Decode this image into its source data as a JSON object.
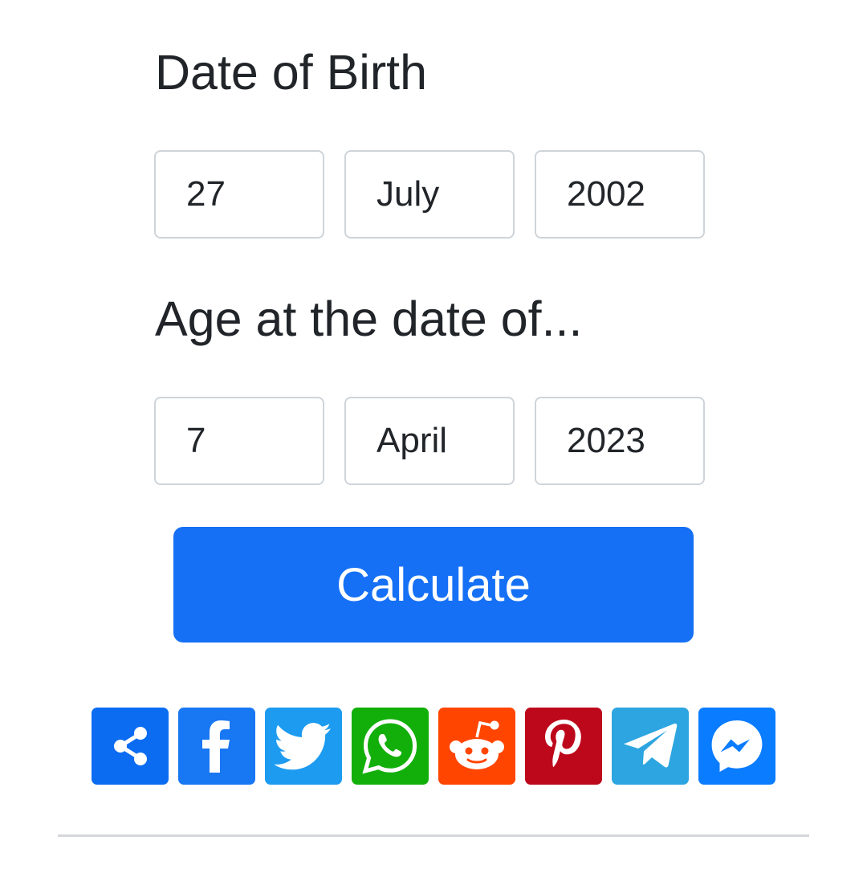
{
  "dob": {
    "label": "Date of Birth",
    "day": "27",
    "month": "July",
    "year": "2002"
  },
  "target": {
    "label": "Age at the date of...",
    "day": "7",
    "month": "April",
    "year": "2023"
  },
  "calculate_label": "Calculate",
  "colors": {
    "accent": "#1570f5",
    "text": "#212529",
    "field_border": "#ced4da"
  },
  "share_buttons": [
    {
      "name": "share",
      "icon": "share-icon",
      "color": "#0b6cf2"
    },
    {
      "name": "facebook",
      "icon": "facebook-icon",
      "color": "#1877f2"
    },
    {
      "name": "twitter",
      "icon": "twitter-icon",
      "color": "#1d9bf0"
    },
    {
      "name": "whatsapp",
      "icon": "whatsapp-icon",
      "color": "#12af0a"
    },
    {
      "name": "reddit",
      "icon": "reddit-icon",
      "color": "#ff4500"
    },
    {
      "name": "pinterest",
      "icon": "pinterest-icon",
      "color": "#bd081c"
    },
    {
      "name": "telegram",
      "icon": "telegram-icon",
      "color": "#2ca5e0"
    },
    {
      "name": "messenger",
      "icon": "messenger-icon",
      "color": "#0a7cff"
    }
  ]
}
